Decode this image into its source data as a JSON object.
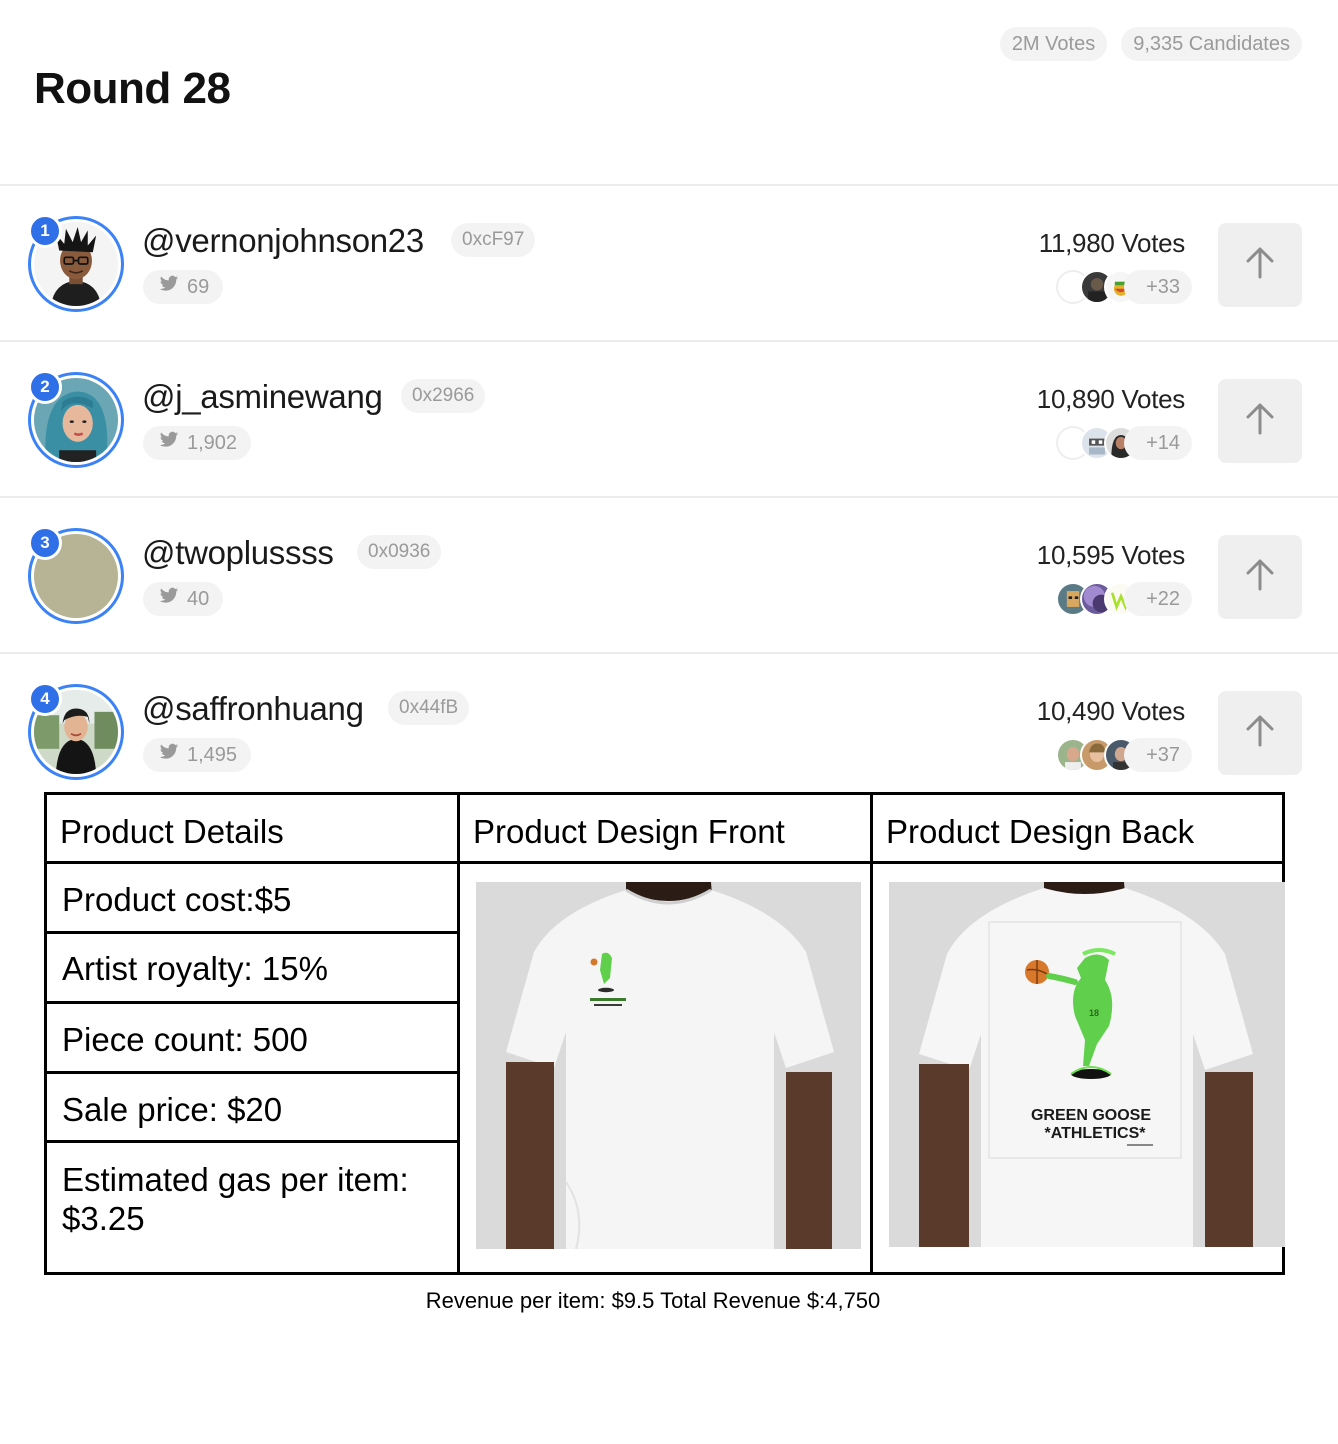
{
  "header": {
    "title": "Round 28",
    "votes_total": "2M Votes",
    "candidates_total": "9,335 Candidates"
  },
  "candidates": [
    {
      "rank": "1",
      "handle": "@vernonjohnson23",
      "address": "0xcF97",
      "twitter_count": "69",
      "votes": "11,980 Votes",
      "extra_voters": "+33"
    },
    {
      "rank": "2",
      "handle": "@j_asminewang",
      "address": "0x2966",
      "twitter_count": "1,902",
      "votes": "10,890 Votes",
      "extra_voters": "+14"
    },
    {
      "rank": "3",
      "handle": "@twoplussss",
      "address": "0x0936",
      "twitter_count": "40",
      "votes": "10,595 Votes",
      "extra_voters": "+22"
    },
    {
      "rank": "4",
      "handle": "@saffronhuang",
      "address": "0x44fB",
      "twitter_count": "1,495",
      "votes": "10,490 Votes",
      "extra_voters": "+37"
    }
  ],
  "product": {
    "headers": [
      "Product Details",
      "Product Design Front",
      "Product Design Back"
    ],
    "details": [
      "Product cost:$5",
      "Artist royalty: 15%",
      "Piece count: 500",
      "Sale price: $20",
      "Estimated gas per item:",
      "$3.25"
    ],
    "shirt_brand_line1": "GREEN GOOSE",
    "shirt_brand_line2": "*ATHLETICS*",
    "revenue_note": "Revenue per item: $9.5 Total Revenue $:4,750"
  },
  "icons": {
    "twitter": "twitter-icon",
    "upvote": "arrow-up-icon"
  },
  "colors": {
    "rank_badge": "#2f6fe8",
    "avatar_ring": "#3b82f6",
    "pill_bg": "#f3f3f3",
    "pill_text": "#9a9a9a",
    "shirt_graphic": "#5fcf4c"
  }
}
